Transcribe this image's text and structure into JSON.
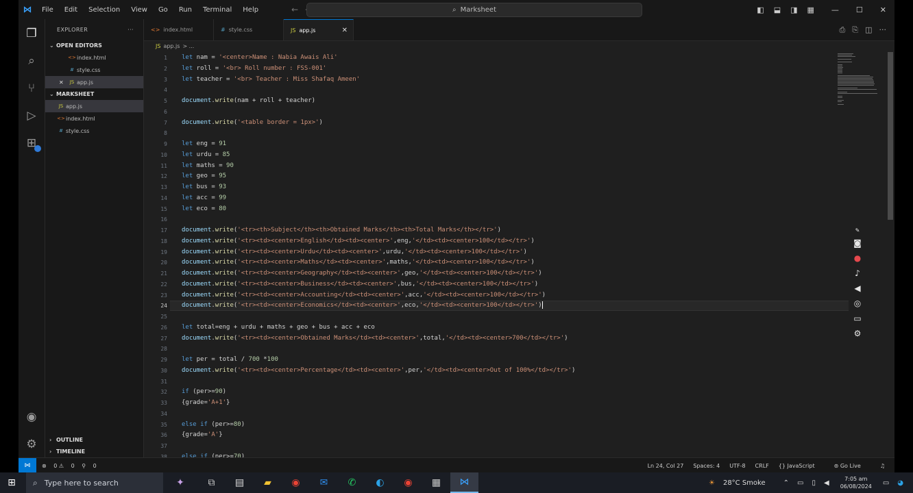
{
  "window": {
    "menu": [
      "File",
      "Edit",
      "Selection",
      "View",
      "Go",
      "Run",
      "Terminal",
      "Help"
    ],
    "search_text": "Marksheet"
  },
  "sidebar": {
    "title": "EXPLORER",
    "open_editors_label": "OPEN EDITORS",
    "open_editors": [
      {
        "name": "index.html",
        "kind": "html"
      },
      {
        "name": "style.css",
        "kind": "css"
      },
      {
        "name": "app.js",
        "kind": "js",
        "active": true
      }
    ],
    "folder_label": "MARKSHEET",
    "files": [
      {
        "name": "app.js",
        "kind": "js",
        "selected": true
      },
      {
        "name": "index.html",
        "kind": "html"
      },
      {
        "name": "style.css",
        "kind": "css"
      }
    ],
    "outline_label": "OUTLINE",
    "timeline_label": "TIMELINE"
  },
  "tabs": [
    {
      "label": "index.html",
      "kind": "html"
    },
    {
      "label": "style.css",
      "kind": "css"
    },
    {
      "label": "app.js",
      "kind": "js",
      "active": true
    }
  ],
  "breadcrumb": {
    "file": "app.js",
    "rest": "> ..."
  },
  "editor": {
    "current_line": 24,
    "lines": [
      {
        "n": "1",
        "t": "let nam = '<center>Name : Nabia Awais Ali'"
      },
      {
        "n": "2",
        "t": "let roll = '<br> Roll number : FSS-001'"
      },
      {
        "n": "3",
        "t": "let teacher = '<br> Teacher : Miss Shafaq Ameen'"
      },
      {
        "n": "4",
        "t": ""
      },
      {
        "n": "5",
        "t": "document.write(nam + roll + teacher)"
      },
      {
        "n": "6",
        "t": ""
      },
      {
        "n": "7",
        "t": "document.write('<table border = 1px>')"
      },
      {
        "n": "8",
        "t": ""
      },
      {
        "n": "9",
        "t": "let eng = 91"
      },
      {
        "n": "10",
        "t": "let urdu = 85"
      },
      {
        "n": "11",
        "t": "let maths = 90"
      },
      {
        "n": "12",
        "t": "let geo = 95"
      },
      {
        "n": "13",
        "t": "let bus = 93"
      },
      {
        "n": "14",
        "t": "let acc = 99"
      },
      {
        "n": "15",
        "t": "let eco = 80"
      },
      {
        "n": "16",
        "t": ""
      },
      {
        "n": "17",
        "t": "document.write('<tr><th>Subject</th><th>Obtained Marks</th><th>Total Marks</th></tr>')"
      },
      {
        "n": "18",
        "t": "document.write('<tr><td><center>English</td><td><center>',eng,'</td><td><center>100</td></tr>')"
      },
      {
        "n": "19",
        "t": "document.write('<tr><td><center>Urdu</td><td><center>',urdu,'</td><td><center>100</td></tr>')"
      },
      {
        "n": "20",
        "t": "document.write('<tr><td><center>Maths</td><td><center>',maths,'</td><td><center>100</td></tr>')"
      },
      {
        "n": "21",
        "t": "document.write('<tr><td><center>Geography</td><td><center>',geo,'</td><td><center>100</td></tr>')"
      },
      {
        "n": "22",
        "t": "document.write('<tr><td><center>Business</td><td><center>',bus,'</td><td><center>100</td></tr>')"
      },
      {
        "n": "23",
        "t": "document.write('<tr><td><center>Accounting</td><td><center>',acc,'</td><td><center>100</td></tr>')"
      },
      {
        "n": "24",
        "t": "document.write('<tr><td><center>Economics</td><td><center>',eco,'</td><td><center>100</td></tr>')"
      },
      {
        "n": "25",
        "t": ""
      },
      {
        "n": "26",
        "t": "let total=eng + urdu + maths + geo + bus + acc + eco"
      },
      {
        "n": "27",
        "t": "document.write('<tr><td><center>Obtained Marks</td><td><center>',total,'</td><td><center>700</td></tr>')"
      },
      {
        "n": "28",
        "t": ""
      },
      {
        "n": "29",
        "t": "let per = total / 700 *100"
      },
      {
        "n": "30",
        "t": "document.write('<tr><td><center>Percentage</td><td><center>',per,'</td><td><center>Out of 100%</td></tr>')"
      },
      {
        "n": "31",
        "t": ""
      },
      {
        "n": "32",
        "t": "if (per>=90)"
      },
      {
        "n": "33",
        "t": "{grade='A+1'}"
      },
      {
        "n": "34",
        "t": ""
      },
      {
        "n": "35",
        "t": "else if (per>=80)"
      },
      {
        "n": "36",
        "t": "{grade='A'}"
      },
      {
        "n": "37",
        "t": ""
      },
      {
        "n": "38",
        "t": "else if (per>=70)"
      }
    ]
  },
  "statusbar": {
    "errors": "0",
    "warnings": "0",
    "ports": "0",
    "position": "Ln 24, Col 27",
    "spaces": "Spaces: 4",
    "encoding": "UTF-8",
    "eol": "CRLF",
    "language": "JavaScript",
    "golive": "Go Live"
  },
  "taskbar": {
    "search_placeholder": "Type here to search",
    "weather": "28°C Smoke",
    "time": "7:05 am",
    "date": "06/08/2024"
  },
  "colors": {
    "accent": "#0078d4",
    "editor_bg": "#1f1f1f",
    "string": "#ce9178",
    "keyword": "#569cd6",
    "function": "#dcdcaa",
    "number": "#b5cea8"
  }
}
